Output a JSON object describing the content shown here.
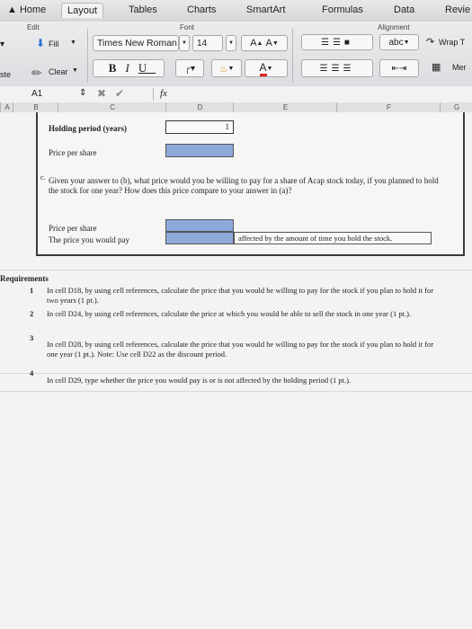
{
  "tabs": [
    "Home",
    "Layout",
    "Tables",
    "Charts",
    "SmartArt",
    "Formulas",
    "Data",
    "Revie"
  ],
  "ribbon": {
    "edit_label": "Edit",
    "font_label": "Font",
    "alignment_label": "Alignment",
    "fill_label": "Fill",
    "clear_label": "Clear",
    "paste_label": "ste",
    "font_name": "Times New Roman",
    "font_size": "14",
    "grow_font": "A",
    "shrink_font": "A",
    "bold": "B",
    "italic": "I",
    "underline": "U",
    "font_color_letter": "A",
    "abc": "abc",
    "wrap_text": "Wrap T",
    "merge": "Mer"
  },
  "formula_bar": {
    "name_box": "A1",
    "fx": "fx"
  },
  "columns": [
    "A",
    "B",
    "C",
    "D",
    "E",
    "F",
    "G"
  ],
  "sheet": {
    "holding_period_label": "Holding period (years)",
    "holding_period_value": "1",
    "price_per_share_label": "Price per share",
    "c_marker": "c.",
    "question_c": "Given your answer to (b), what price would you be willing to pay for a share of Acap stock today, if you planned to hold the stock for one year? How does this price compare to your answer in (a)?",
    "price_per_share_label2": "Price per share",
    "price_you_pay_label": "The price you would pay",
    "affected_text": "affected by the amount of time you hold the stock."
  },
  "requirements": {
    "title": "Requirements",
    "items": [
      {
        "num": "1",
        "text": "In cell D18, by using cell references, calculate the price that you would be willing to pay for the stock if you plan to hold it for two years (1 pt.)."
      },
      {
        "num": "2",
        "text": "In cell D24, by using cell references, calculate the price at which you would be able to sell the stock in one year (1 pt.)."
      },
      {
        "num": "3",
        "text": "In cell D28, by using cell references, calculate the price that you would be willing to pay for the stock if you plan to hold it for one year (1 pt.). Note: Use cell D22 as the discount period."
      },
      {
        "num": "4",
        "text": "In cell D29, type whether the price you would pay is or is not affected by the holding period (1 pt.)."
      }
    ]
  },
  "colors": {
    "input_fill": "#8eaadb",
    "frame": "#3a3a3a"
  }
}
